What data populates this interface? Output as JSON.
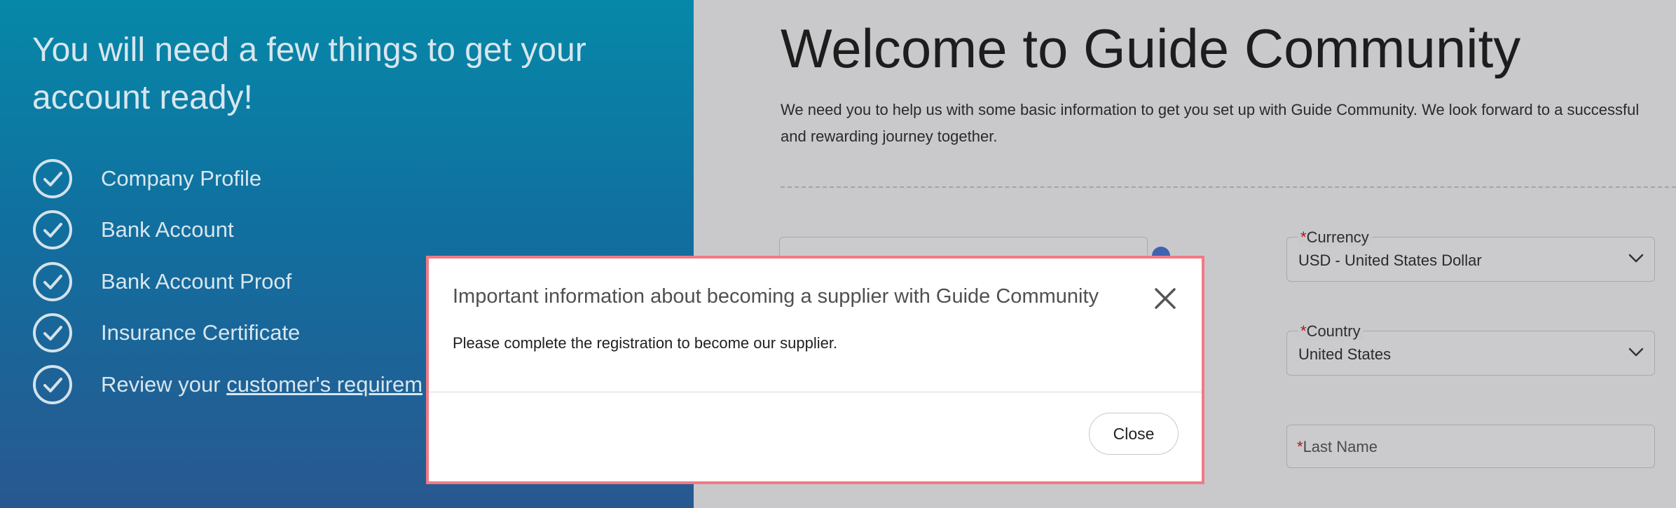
{
  "left_panel": {
    "heading": "You will need a few things to get your account ready!",
    "items": [
      {
        "label": "Company Profile"
      },
      {
        "label": "Bank Account"
      },
      {
        "label": "Bank Account Proof"
      },
      {
        "label": "Insurance Certificate"
      },
      {
        "label_prefix": "Review your ",
        "link_text": "customer's requirem"
      }
    ],
    "icon": "check-circle-icon"
  },
  "main": {
    "title": "Welcome to Guide Community",
    "intro": "We need you to help us with some basic information to get you set up with Guide Community. We look forward to a successful and rewarding journey together.",
    "fields": {
      "currency": {
        "label": "Currency",
        "required_mark": "*",
        "value": "USD - United States Dollar"
      },
      "country": {
        "label": "Country",
        "required_mark": "*",
        "value": "United States"
      },
      "last_name": {
        "label": "Last Name",
        "required_mark": "*",
        "value": ""
      }
    }
  },
  "modal": {
    "title": "Important information about becoming a supplier with Guide Community",
    "body": "Please complete the registration to become our supplier.",
    "close_button_label": "Close",
    "close_icon": "close-icon",
    "border_color": "#f07a86"
  },
  "colors": {
    "gradient_top": "#0688a8",
    "gradient_bottom": "#285890",
    "required": "#b3131b",
    "help_icon": "#3f63b0"
  }
}
